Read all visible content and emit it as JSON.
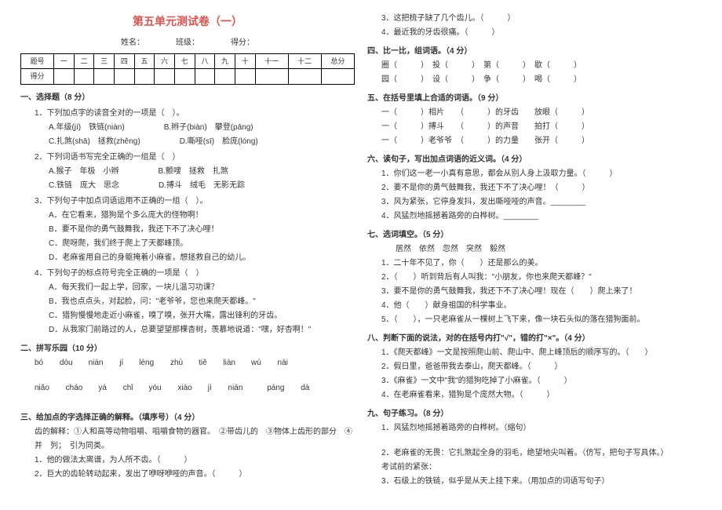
{
  "title": "第五单元测试卷（一）",
  "header": {
    "name": "姓名：",
    "class": "班级：",
    "score": "得分："
  },
  "scoreTable": {
    "cols": [
      "题号",
      "一",
      "二",
      "三",
      "四",
      "五",
      "六",
      "七",
      "八",
      "九",
      "十",
      "十一",
      "十二",
      "总分"
    ],
    "row2": "得分"
  },
  "s1": {
    "h": "一、选择题（8 分）",
    "q1": "1．下列加点字的读音全对的一项是（　）。",
    "q1a": "A.年级(jí)　铁链(niàn)",
    "q1b": "B.辫子(biàn)　攀登(pāng)",
    "q1c": "C.扎煞(shā)　拯救(zhěng)",
    "q1d": "D.嘶哑(sī)　脸庞(lóng)",
    "q2": "2．下列词语书写完全正确的一组是（　）",
    "q2a": "A.猴子　年极　小辫",
    "q2b": "B.颤嗖　拯救　扎煞",
    "q2c": "C.铁链　庞大　思念",
    "q2d": "D.搏斗　绒毛　无影无踪",
    "q3": "3．下列句子中加点词语运用不正确的一组（　）。",
    "q3a": "A．在它看来，猎狗是个多么庞大的怪物啊！",
    "q3b": "B．要不是你的勇气鼓舞我，我还下不了决心哩！",
    "q3c": "C．爬呀爬，我们终于爬上了天都峰顶。",
    "q3d": "D．老麻雀用自己的身躯掩着小麻雀，想拯救自己的幼儿。",
    "q4": "4．下列句子的标点符号完全正确的一项是（　）",
    "q4a": "A．每天我们一起上学，回家，一块儿温习功课？",
    "q4b": "B．我也点点头，对起脸，问：\"老爷爷，您也来爬天都峰。\"",
    "q4c": "C．猎狗慢慢地走近小麻雀，嗅了嗅，张开大嘴，露出锋利的牙齿。",
    "q4d": "D．从我家门前路过的人，总要望望那棵杏树，羡慕地说道：\"嘿，好杏啊！\""
  },
  "s2": {
    "h": "二、拼写乐园（10 分）",
    "p1": "bó dòu　　nián jí　　lèng zhù　　tiě liàn　　wú nài",
    "p2": "niǎo cháo　　yá chǐ　　yóu xiào　　jì niàn　 páng dà"
  },
  "s3": {
    "h": "三、给加点的字选择正确的解释。（填序号）（4 分）",
    "ref": "齿的解释：①人和高等动物咀嚼、咀嚼食物的器官。　②带齿儿的　③物体上齿形的部分　④并　列；　引为同类。",
    "q1": "1．他的做法太离谱，为人所不齿。（　　　）",
    "q2": "2．巨大的齿轮转动起来，发出了咿呀咿哑的声音。（　　　）"
  },
  "r_top": {
    "q3": "3．这把梳子缺了几个齿儿。（　　　）",
    "q4": "4．最近我的牙齿很痛。（　　　）"
  },
  "s4": {
    "h": "四、比一比，组词语。（4 分）",
    "l1": "圈（　　　）　投（　　　）　第（　　　）　歇（　　　）",
    "l2": "园（　　　）　设（　　　）　争（　　　）　喝（　　　）"
  },
  "s5": {
    "h": "五、在括号里填上合适的词语。（9 分）",
    "l1": "一（　　　）相片　　（　　　）的牙齿　　放眼（　　　）",
    "l2": "一（　　　）搏斗　　（　　　）的声音　　拍打（　　　）",
    "l3": "一（　　　）老爷爷　（　　　）的力量　　张开（　　　）"
  },
  "s6": {
    "h": "六、读句子，写出加点词语的近义词。（4 分）",
    "q1": "1．你们这一老一小真有意思，都会从别人身上汲取力量。（　　　）",
    "q2": "2．要不是你的勇气鼓舞我，我还下不了决心哩！（　　　）",
    "q3": "3．风为紧张，它停身发抖，发出嘶哑哑的声音。________",
    "q4": "4．风猛烈地摇撼着路旁的白桦树。________"
  },
  "s7": {
    "h": "七、选词填空。（5 分）",
    "words": "居然　依然　忽然　突然　毅然",
    "q1": "1．二十年不见了，你（　　）还是那么的美。",
    "q2": "2．（　　）听到背后有人叫我：\"小朋友，你也来爬天都峰？\"",
    "q3": "3．要不是你的勇气鼓舞我，我还下不了决心哩！现在（　　）爬上来了！",
    "q4": "4．他（　　）献身祖国的科学事业。",
    "q5": "5．（　　），一只老麻雀从一棵树上飞下来，像一块石头似的落在猎狗面前。"
  },
  "s8": {
    "h": "八、判断下面的说法，对的在括号内打\"√\"，错的打\"×\"。（4 分）",
    "q1": "1．《爬天都峰》一文是按照爬山前、爬山中、爬上峰顶后的顺序写的。（　　）",
    "q2": "2．假日里，爸爸带我去泰山，爬天都峰。（　　　）",
    "q3": "3．《麻雀》一文中\"我\"的猎狗吃掉了小麻雀。（　　　）",
    "q4": "4．在老麻雀看来，猎狗是个庞然大物。（　　　）"
  },
  "s9": {
    "h": "九、句子练习。（8 分）",
    "q1": "1．风猛烈地摇撼着路旁的白桦树。（缩句）",
    "q2": "2．老麻雀的无畏：它扎煞起全身的羽毛，绝望地尖叫着。（仿写，把句子写具体。）",
    "q2b": "考试前的紧张：",
    "q3": "3．石级上的铁链，似乎是从天上挂下来。（用加点的词语写句子）"
  }
}
